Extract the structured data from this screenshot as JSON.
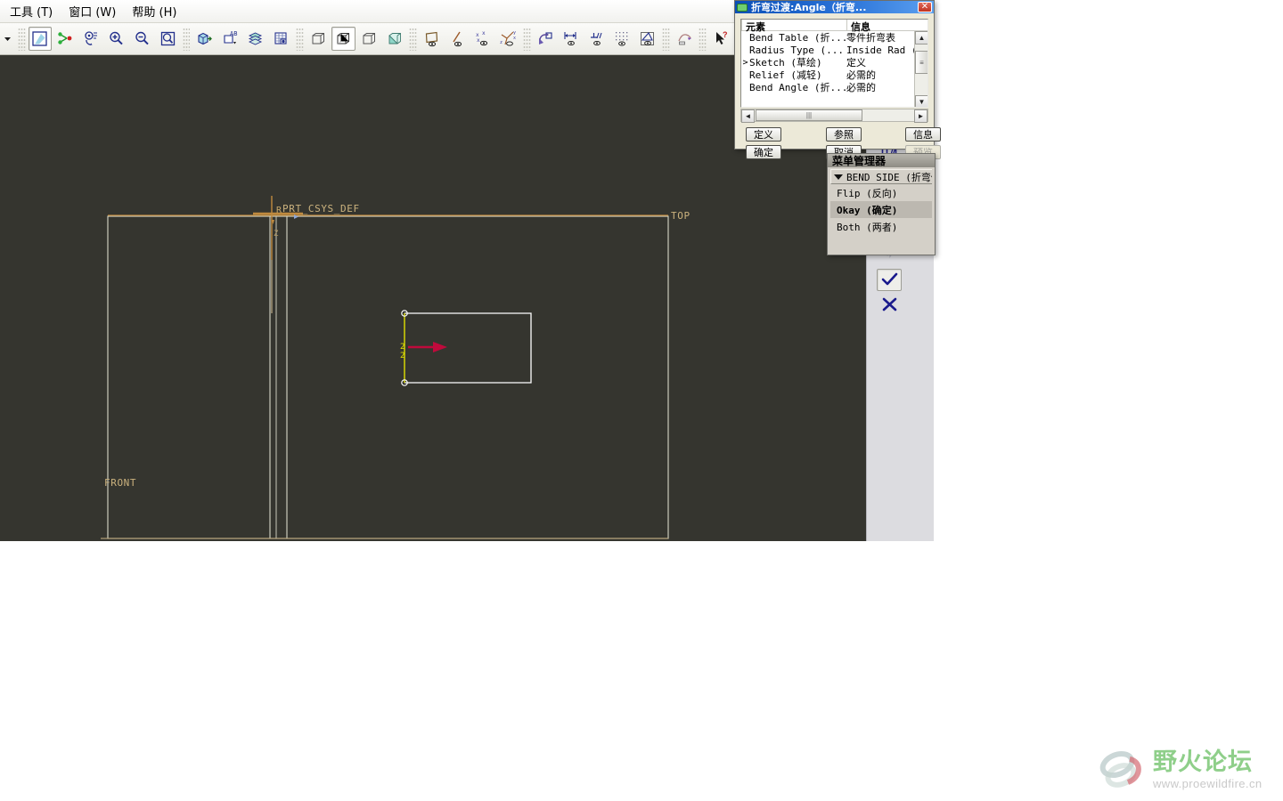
{
  "app": {
    "viewport_bg": "#35352f",
    "panel_bg": "#dcdce0"
  },
  "menubar": {
    "items": [
      {
        "label": "工具 (T)",
        "name": "menu-tools"
      },
      {
        "label": "窗口 (W)",
        "name": "menu-window"
      },
      {
        "label": "帮助 (H)",
        "name": "menu-help"
      }
    ]
  },
  "toolbar": {
    "buttons": [
      {
        "name": "overflow-dropdown-icon",
        "icon": "caret-down"
      },
      {
        "name": "repaint-icon",
        "icon": "repaint"
      },
      {
        "name": "spin-center-icon",
        "icon": "spin-center"
      },
      {
        "name": "reorient-icon",
        "icon": "reorient"
      },
      {
        "name": "zoom-in-icon",
        "icon": "zoom-in"
      },
      {
        "name": "zoom-out-icon",
        "icon": "zoom-out"
      },
      {
        "name": "refit-icon",
        "icon": "refit"
      },
      {
        "name": "saved-views-icon",
        "icon": "saved-views"
      },
      {
        "name": "annotation-display-icon",
        "icon": "annotation"
      },
      {
        "name": "layers-icon",
        "icon": "layers"
      },
      {
        "name": "appearance-gallery-icon",
        "icon": "appearance"
      },
      {
        "name": "wireframe-view-icon",
        "icon": "cube-wire"
      },
      {
        "name": "hidden-line-view-icon",
        "icon": "cube-hidden"
      },
      {
        "name": "no-hidden-view-icon",
        "icon": "cube-nohidden"
      },
      {
        "name": "shaded-view-icon",
        "icon": "cube-shaded"
      },
      {
        "name": "datum-plane-display-icon",
        "icon": "datum-plane"
      },
      {
        "name": "datum-axis-display-icon",
        "icon": "datum-axis"
      },
      {
        "name": "datum-point-display-icon",
        "icon": "datum-point"
      },
      {
        "name": "datum-csys-display-icon",
        "icon": "datum-csys"
      },
      {
        "name": "spin-model-icon",
        "icon": "spin-model"
      },
      {
        "name": "dimension-display-icon",
        "icon": "dimension"
      },
      {
        "name": "constraint-display-icon",
        "icon": "constraint"
      },
      {
        "name": "grid-display-icon",
        "icon": "grid"
      },
      {
        "name": "vertex-display-icon",
        "icon": "vertex"
      },
      {
        "name": "sketch-tools-icon",
        "icon": "sketch-tools"
      },
      {
        "name": "context-help-icon",
        "icon": "help-arrow"
      }
    ],
    "pressed_indices": [
      1,
      12,
      24
    ]
  },
  "viewport": {
    "labels": {
      "csys": "PRT_CSYS_DEF",
      "csys_prefix": "R",
      "top_plane": "TOP",
      "front_plane": "FRONT"
    },
    "colors": {
      "datum_plane": "#d9d9c8",
      "csys": "#c08a3e",
      "bend_line": "#e0e000",
      "direction_arrow": "#c00a3c",
      "sketch_edge": "#ffffff"
    }
  },
  "right_panel": {
    "buttons": [
      {
        "name": "rect-sketch-icon",
        "icon": "rect",
        "caret": true,
        "state": "normal"
      },
      {
        "name": "dimension-tool-icon",
        "icon": "dim",
        "caret": false,
        "state": "normal"
      },
      {
        "name": "modify-dim-icon",
        "icon": "modify-dim",
        "caret": false,
        "state": "normal"
      },
      {
        "name": "constraint-tool-icon",
        "icon": "constraint",
        "caret": false,
        "state": "normal"
      },
      {
        "name": "text-tool-icon",
        "icon": "text",
        "caret": false,
        "state": "disabled"
      },
      {
        "name": "palette-tool-icon",
        "icon": "palette",
        "caret": false,
        "state": "normal"
      },
      {
        "name": "trim-tool-icon",
        "icon": "trim",
        "caret": true,
        "state": "normal"
      },
      {
        "name": "mirror-tool-icon",
        "icon": "mirror",
        "caret": true,
        "state": "disabled"
      },
      {
        "name": "accept-sketch-icon",
        "icon": "check",
        "caret": false,
        "state": "pressed"
      },
      {
        "name": "cancel-sketch-icon",
        "icon": "cross",
        "caret": false,
        "state": "normal"
      }
    ]
  },
  "element_dialog": {
    "title": "折弯过渡:Angle（折弯...",
    "close_label": "✕",
    "columns": [
      "元素",
      "信息"
    ],
    "rows": [
      {
        "marker": "",
        "element": "Bend Table (折...",
        "info": "零件折弯表"
      },
      {
        "marker": "",
        "element": "Radius Type (...",
        "info": "Inside Rad (内"
      },
      {
        "marker": ">",
        "element": "Sketch (草绘)",
        "info": "定义"
      },
      {
        "marker": "",
        "element": "Relief (减轻)",
        "info": "必需的"
      },
      {
        "marker": "",
        "element": "Bend Angle (折...",
        "info": "必需的"
      }
    ],
    "buttons": [
      {
        "label": "定义",
        "name": "define-button",
        "disabled": false
      },
      {
        "label": "参照",
        "name": "refs-button",
        "disabled": false
      },
      {
        "label": "信息",
        "name": "info-button",
        "disabled": false
      },
      {
        "label": "确定",
        "name": "ok-button",
        "disabled": false
      },
      {
        "label": "取消",
        "name": "cancel-button",
        "disabled": false
      },
      {
        "label": "预览",
        "name": "preview-button",
        "disabled": true
      }
    ]
  },
  "menu_manager": {
    "title": "菜单管理器",
    "section": "BEND SIDE (折弯侧",
    "items": [
      {
        "label": "Flip (反向)",
        "name": "menu-flip",
        "selected": false
      },
      {
        "label": "Okay (确定)",
        "name": "menu-okay",
        "selected": true
      },
      {
        "label": "Both (两者)",
        "name": "menu-both",
        "selected": false
      }
    ]
  },
  "watermark": {
    "title": "野火论坛",
    "url": "www.proewildfire.cn"
  }
}
